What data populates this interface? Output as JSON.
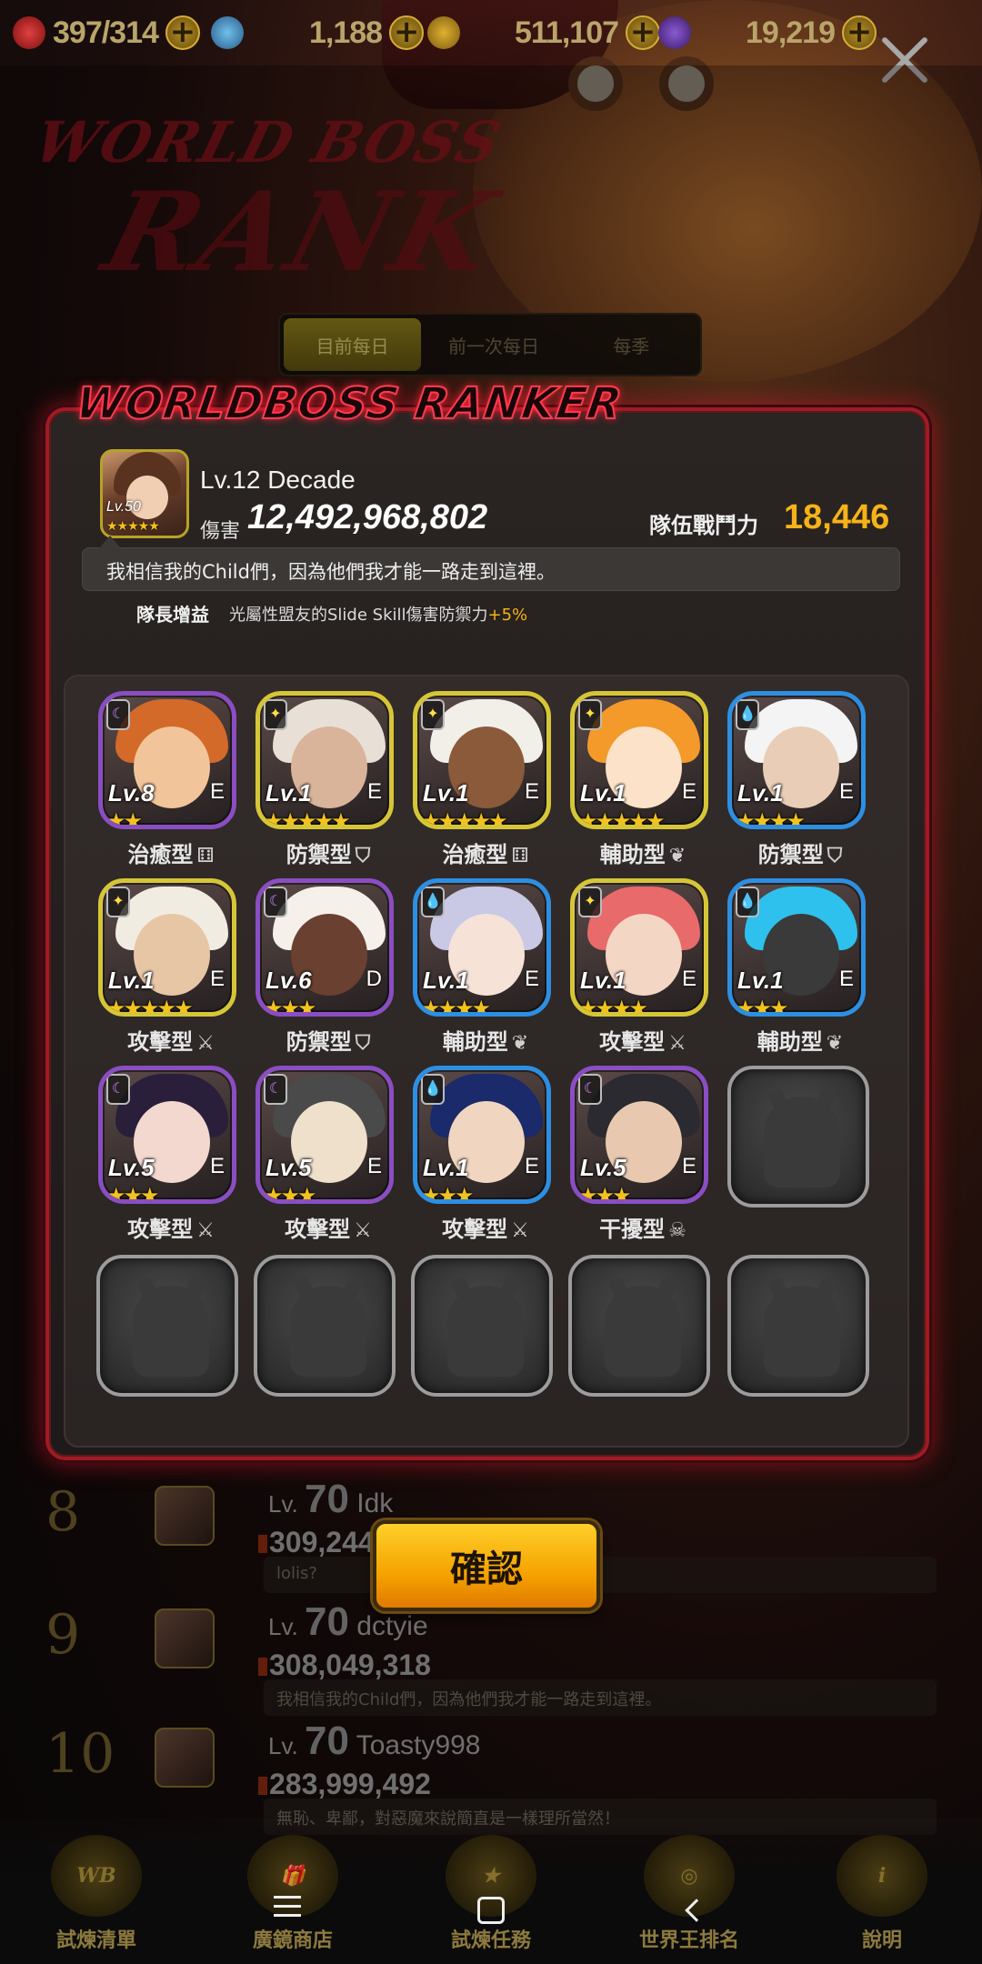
{
  "resources": [
    {
      "name": "stamina",
      "icon": "heart-icon",
      "value": "397/314"
    },
    {
      "name": "crystal",
      "icon": "crystal-icon",
      "value": "1,188"
    },
    {
      "name": "gold",
      "icon": "coin-icon",
      "value": "511,107"
    },
    {
      "name": "soul",
      "icon": "soul-icon",
      "value": "19,219"
    }
  ],
  "tabs": [
    {
      "label": "目前每日",
      "active": true
    },
    {
      "label": "前一次每日",
      "active": false
    },
    {
      "label": "每季",
      "active": false
    }
  ],
  "panel": {
    "title": "WORLDBOSS RANKER",
    "leader": {
      "avatar_level": "Lv.50",
      "avatar_stars": "★★★★★",
      "name": "Lv.12 Decade",
      "damage_label": "傷害",
      "damage": "12,492,968,802",
      "team_power_label": "隊伍戰鬥力",
      "team_power": "18,446",
      "motto": "我相信我的Child們，因為他們我才能一路走到這裡。",
      "bonus_label": "隊長增益",
      "bonus_text": "光屬性盟友的Slide Skill傷害防禦力",
      "bonus_value": "+5%"
    },
    "team": [
      {
        "level": "Lv.8",
        "grade": "E",
        "stars": "★★",
        "role": "治癒型",
        "role_icon": "⚅",
        "attr": "moon",
        "frame": "purple"
      },
      {
        "level": "Lv.1",
        "grade": "E",
        "stars": "★★★★★",
        "role": "防禦型",
        "role_icon": "⛉",
        "attr": "light",
        "frame": "yellow"
      },
      {
        "level": "Lv.1",
        "grade": "E",
        "stars": "★★★★★",
        "role": "治癒型",
        "role_icon": "⚅",
        "attr": "light",
        "frame": "yellow"
      },
      {
        "level": "Lv.1",
        "grade": "E",
        "stars": "★★★★★",
        "role": "輔助型",
        "role_icon": "❦",
        "attr": "light",
        "frame": "yellow"
      },
      {
        "level": "Lv.1",
        "grade": "E",
        "stars": "★★★★",
        "role": "防禦型",
        "role_icon": "⛉",
        "attr": "water",
        "frame": "blue"
      },
      {
        "level": "Lv.1",
        "grade": "E",
        "stars": "★★★★★",
        "role": "攻擊型",
        "role_icon": "⚔",
        "attr": "light",
        "frame": "yellow"
      },
      {
        "level": "Lv.6",
        "grade": "D",
        "stars": "★★★",
        "role": "防禦型",
        "role_icon": "⛉",
        "attr": "moon",
        "frame": "purple"
      },
      {
        "level": "Lv.1",
        "grade": "E",
        "stars": "★★★★",
        "role": "輔助型",
        "role_icon": "❦",
        "attr": "water",
        "frame": "blue"
      },
      {
        "level": "Lv.1",
        "grade": "E",
        "stars": "★★★★",
        "role": "攻擊型",
        "role_icon": "⚔",
        "attr": "light",
        "frame": "yellow"
      },
      {
        "level": "Lv.1",
        "grade": "E",
        "stars": "★★★",
        "role": "輔助型",
        "role_icon": "❦",
        "attr": "water",
        "frame": "blue"
      },
      {
        "level": "Lv.5",
        "grade": "E",
        "stars": "★★★",
        "role": "攻擊型",
        "role_icon": "⚔",
        "attr": "moon",
        "frame": "purple"
      },
      {
        "level": "Lv.5",
        "grade": "E",
        "stars": "★★★",
        "role": "攻擊型",
        "role_icon": "⚔",
        "attr": "moon",
        "frame": "purple"
      },
      {
        "level": "Lv.1",
        "grade": "E",
        "stars": "★★★",
        "role": "攻擊型",
        "role_icon": "⚔",
        "attr": "water",
        "frame": "blue"
      },
      {
        "level": "Lv.5",
        "grade": "E",
        "stars": "★★★",
        "role": "干擾型",
        "role_icon": "☠",
        "attr": "moon",
        "frame": "purple"
      }
    ],
    "confirm_label": "確認"
  },
  "background_list": [
    {
      "rank": "8",
      "level": "70",
      "name": "Idk",
      "score": "309,244,...",
      "message": "lolis?"
    },
    {
      "rank": "9",
      "level": "70",
      "name": "dctyie",
      "score": "308,049,318",
      "message": "我相信我的Child們，因為他們我才能一路走到這裡。"
    },
    {
      "rank": "10",
      "level": "70",
      "name": "Toasty998",
      "score": "283,999,492",
      "message": "無恥、卑鄙，對惡魔來說簡直是一樣理所當然！"
    }
  ],
  "bottom_nav": [
    {
      "label": "試煉清單",
      "icon": "world-boss-icon"
    },
    {
      "label": "廣鏡商店",
      "icon": "gift-icon"
    },
    {
      "label": "試煉任務",
      "icon": "mission-icon"
    },
    {
      "label": "世界王排名",
      "icon": "rank-icon"
    },
    {
      "label": "說明",
      "icon": "info-icon"
    }
  ],
  "bg_title": {
    "line1": "WORLD BOSS",
    "line2": "RANK"
  }
}
